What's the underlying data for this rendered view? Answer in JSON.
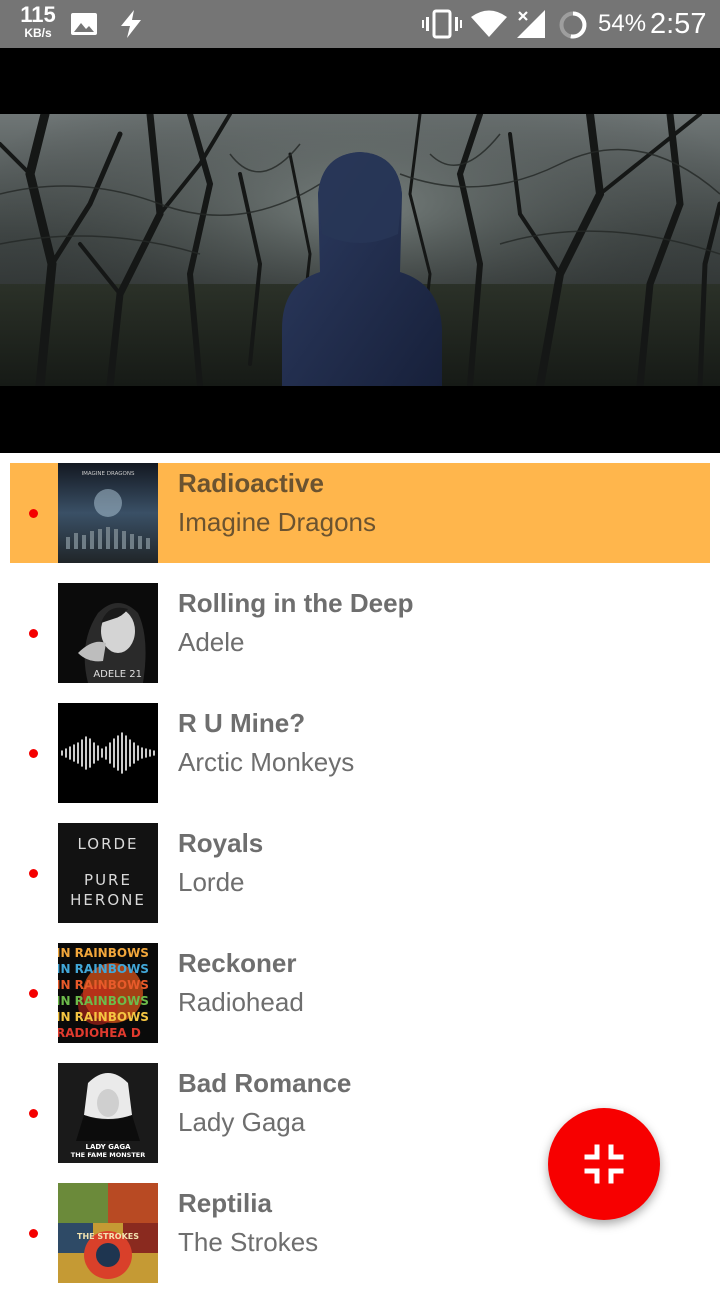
{
  "status_bar": {
    "speed_value": "115",
    "speed_unit": "KB/s",
    "battery": "54%",
    "time": "2:57",
    "icons": [
      "image-icon",
      "flash-icon",
      "vibrate-icon",
      "wifi-icon",
      "signal-icon",
      "battery-icon"
    ]
  },
  "video": {
    "description_icon": "video-player"
  },
  "playlist": [
    {
      "title": "Radioactive",
      "artist": "Imagine Dragons",
      "active": true
    },
    {
      "title": "Rolling in the Deep",
      "artist": "Adele",
      "active": false
    },
    {
      "title": "R U Mine?",
      "artist": "Arctic Monkeys",
      "active": false
    },
    {
      "title": "Royals",
      "artist": "Lorde",
      "active": false
    },
    {
      "title": "Reckoner",
      "artist": "Radiohead",
      "active": false
    },
    {
      "title": "Bad Romance",
      "artist": "Lady Gaga",
      "active": false
    },
    {
      "title": "Reptilia",
      "artist": "The Strokes",
      "active": false
    }
  ],
  "album_art_text": {
    "imagine_dragons": "IMAGINE DRAGONS",
    "adele": "ADELE 21",
    "lorde_1": "LORDE",
    "lorde_2": "PURE",
    "lorde_3": "HERONE",
    "radiohead_rows": [
      "IN RAINBOWS",
      "IN RAINBOWS",
      "IN RAINBOWS",
      "IN RAINBOWS",
      "IN RAINBOWS",
      "RADIOHEA D"
    ],
    "gaga_1": "LADY GAGA",
    "gaga_2": "THE FAME MONSTER",
    "strokes": "THE STROKES"
  },
  "fab": {
    "icon": "fullscreen-exit-icon"
  },
  "colors": {
    "status_bar": "#757575",
    "active_row": "#ffb64c",
    "dot": "#f40000",
    "fab": "#f70000",
    "text": "#6e6e6e"
  }
}
